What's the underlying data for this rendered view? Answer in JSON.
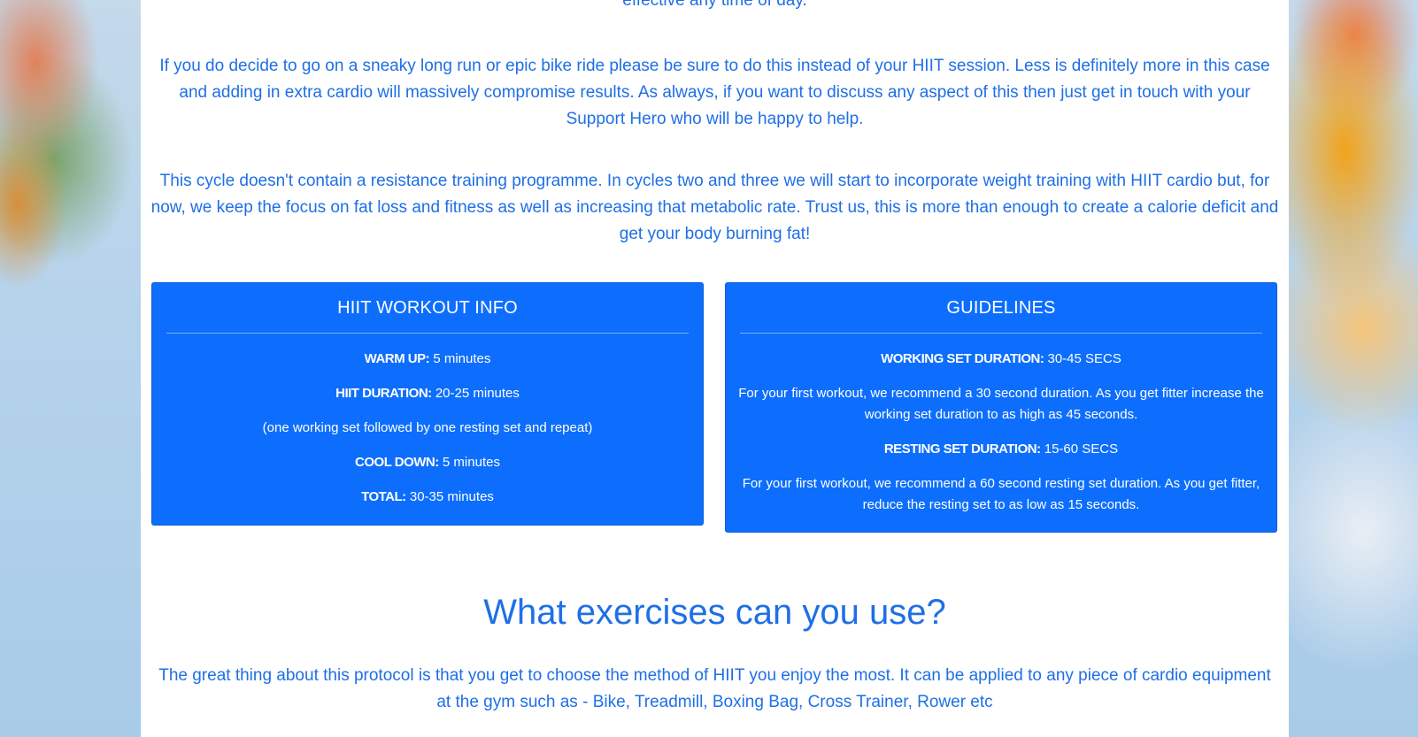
{
  "page": {
    "intro_tail": "effective any time of day.",
    "paragraph_1": "If you do decide to go on a sneaky long run or epic bike ride please be sure to do this instead of your HIIT session. Less is definitely more in this case and adding in extra cardio will massively compromise results. As always, if you want to discuss any aspect of this then just get in touch with your Support Hero who will be happy to help.",
    "paragraph_2": "This cycle doesn't contain a resistance training programme. In cycles two and three we will start to incorporate weight training with HIIT cardio but, for now, we keep the focus on fat loss and fitness as well as increasing that metabolic rate. Trust us, this is more than enough to create a calorie deficit and get your body burning fat!"
  },
  "workout_card": {
    "title": "HIIT WORKOUT INFO",
    "warm_up_label": "WARM UP:",
    "warm_up_value": "5 minutes",
    "hiit_duration_label": "HIIT DURATION:",
    "hiit_duration_value": "20-25 minutes",
    "hiit_note": "(one working set followed by one resting set and repeat)",
    "cool_down_label": "COOL DOWN:",
    "cool_down_value": "5 minutes",
    "total_label": "TOTAL:",
    "total_value": "30-35 minutes"
  },
  "guidelines_card": {
    "title": "GUIDELINES",
    "working_label": "WORKING SET DURATION:",
    "working_value": "30-45 SECS",
    "working_note": "For your first workout, we recommend a 30 second duration. As you get fitter increase the working set duration to as high as 45 seconds.",
    "resting_label": "RESTING SET DURATION:",
    "resting_value": "15-60 SECS",
    "resting_note": "For your first workout, we recommend a 60 second resting set duration. As you get fitter, reduce the resting set to as low as 15 seconds."
  },
  "exercises": {
    "heading": "What exercises can you use?",
    "paragraph": "The great thing about this protocol is that you get to choose the method of HIIT you enjoy the most. It can be applied to any piece of cardio equipment at the gym such as - Bike, Treadmill, Boxing Bag, Cross Trainer, Rower etc"
  },
  "colors": {
    "accent_text": "#1f6fe6",
    "card_background": "#0d6efd",
    "card_text": "#ffffff",
    "content_background": "#ffffff"
  }
}
